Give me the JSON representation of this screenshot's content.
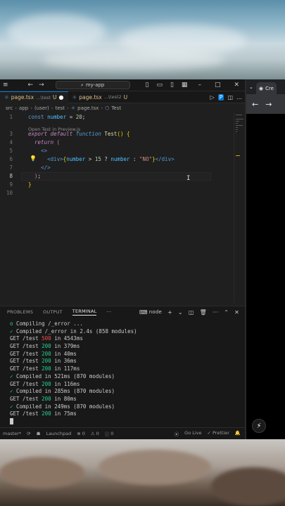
{
  "titlebar": {
    "search": "my-app"
  },
  "tabs": [
    {
      "file": "page.tsx",
      "path": "...\\test",
      "status": "U",
      "active": true
    },
    {
      "file": "page.tsx",
      "path": "...\\test2",
      "status": "U",
      "active": false
    }
  ],
  "breadcrumbs": [
    "src",
    "app",
    "(user)",
    "test",
    "page.tsx",
    "Test"
  ],
  "editor": {
    "codelens": "Open Test in Preview.js",
    "line_numbers": [
      "1",
      "2",
      "3",
      "4",
      "5",
      "6",
      "7",
      "8",
      "9",
      "10"
    ]
  },
  "panel": {
    "tabs": [
      "PROBLEMS",
      "OUTPUT",
      "TERMINAL"
    ],
    "active_tab": "TERMINAL",
    "terminal_name": "node",
    "lines": [
      {
        "t": "o Compiling /_error ..."
      },
      {
        "t": "✓ Compiled /_error in 2.4s (858 modules)"
      },
      {
        "t": "GET /test 500 in 4543ms"
      },
      {
        "t": "GET /test 200 in 379ms"
      },
      {
        "t": "GET /test 200 in 40ms"
      },
      {
        "t": "GET /test 200 in 36ms"
      },
      {
        "t": "GET /test 200 in 117ms"
      },
      {
        "t": "✓ Compiled in 521ms (870 modules)"
      },
      {
        "t": "GET /test 200 in 116ms"
      },
      {
        "t": "✓ Compiled in 285ms (870 modules)"
      },
      {
        "t": "GET /test 200 in 80ms"
      },
      {
        "t": "✓ Compiled in 249ms (870 modules)"
      },
      {
        "t": "GET /test 200 in 75ms"
      }
    ]
  },
  "statusbar": {
    "branch": "master*",
    "launchpad": "Launchpad",
    "errors": "0",
    "warnings": "0",
    "info": "0",
    "golive": "Go Live",
    "prettier": "Prettier"
  },
  "browser": {
    "tab_title": "Cre"
  },
  "colors": {
    "accent": "#0078d4",
    "ok": "#23d18b",
    "error": "#f14c4c"
  }
}
